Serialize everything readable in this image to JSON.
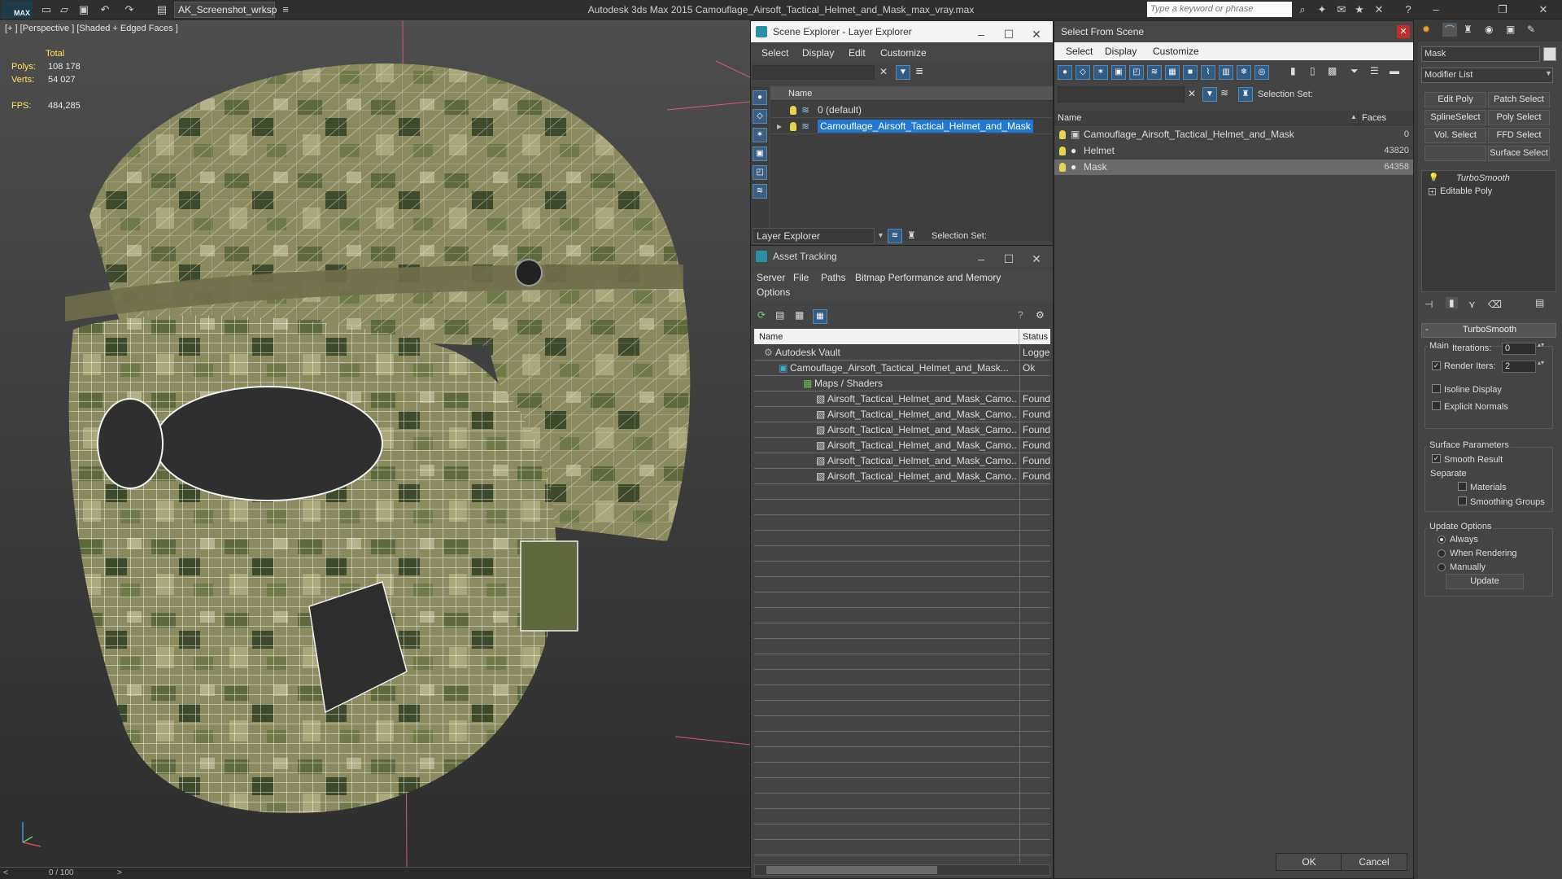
{
  "titlebar": {
    "logo": "MAX",
    "workspace": "AK_Screenshot_wrksp",
    "title": "Autodesk 3ds Max  2015    Camouflage_Airsoft_Tactical_Helmet_and_Mask_max_vray.max",
    "search_placeholder": "Type a keyword or phrase"
  },
  "viewport": {
    "label": "[+ ] [Perspective ] [Shaded + Edged Faces ]",
    "stats": {
      "total_label": "Total",
      "polys_label": "Polys:",
      "polys_value": "108 178",
      "verts_label": "Verts:",
      "verts_value": "54 027",
      "fps_label": "FPS:",
      "fps_value": "484,285"
    },
    "timeline": "0 / 100"
  },
  "scene_explorer": {
    "title": "Scene Explorer - Layer Explorer",
    "menu": [
      "Select",
      "Display",
      "Edit",
      "Customize"
    ],
    "col_name": "Name",
    "rows": [
      "0 (default)",
      "Camouflage_Airsoft_Tactical_Helmet_and_Mask"
    ],
    "footer_dropdown": "Layer Explorer",
    "selection_set": "Selection Set:"
  },
  "asset_tracking": {
    "title": "Asset Tracking",
    "menu": [
      "Server",
      "File",
      "Paths",
      "Bitmap Performance and Memory",
      "Options"
    ],
    "col_name": "Name",
    "col_status": "Status",
    "rows": [
      {
        "name": "Autodesk Vault",
        "status": "Logged"
      },
      {
        "name": "Camouflage_Airsoft_Tactical_Helmet_and_Mask...",
        "status": "Ok"
      },
      {
        "name": "Maps / Shaders",
        "status": ""
      },
      {
        "name": "Airsoft_Tactical_Helmet_and_Mask_Camo...",
        "status": "Found"
      },
      {
        "name": "Airsoft_Tactical_Helmet_and_Mask_Camo...",
        "status": "Found"
      },
      {
        "name": "Airsoft_Tactical_Helmet_and_Mask_Camo...",
        "status": "Found"
      },
      {
        "name": "Airsoft_Tactical_Helmet_and_Mask_Camo...",
        "status": "Found"
      },
      {
        "name": "Airsoft_Tactical_Helmet_and_Mask_Camo...",
        "status": "Found"
      },
      {
        "name": "Airsoft_Tactical_Helmet_and_Mask_Camo...",
        "status": "Found"
      }
    ]
  },
  "select_from_scene": {
    "title": "Select From Scene",
    "menu": [
      "Select",
      "Display",
      "Customize"
    ],
    "selection_set": "Selection Set:",
    "col_name": "Name",
    "col_faces": "Faces",
    "rows": [
      {
        "name": "Camouflage_Airsoft_Tactical_Helmet_and_Mask",
        "faces": "0"
      },
      {
        "name": "Helmet",
        "faces": "43820"
      },
      {
        "name": "Mask",
        "faces": "64358"
      }
    ],
    "ok": "OK",
    "cancel": "Cancel"
  },
  "command_panel": {
    "object_name": "Mask",
    "modifier_list": "Modifier List",
    "buttons": [
      "Edit Poly",
      "Patch Select",
      "SplineSelect",
      "Poly Select",
      "Vol. Select",
      "FFD Select",
      "Surface Select"
    ],
    "stack": [
      "TurboSmooth",
      "Editable Poly"
    ],
    "rollout_title": "TurboSmooth",
    "main_label": "Main",
    "iterations_label": "Iterations:",
    "iterations_value": "0",
    "render_iters_label": "Render Iters:",
    "render_iters_value": "2",
    "isoline": "Isoline Display",
    "explicit_normals": "Explicit Normals",
    "surface_params": "Surface Parameters",
    "smooth_result": "Smooth Result",
    "separate": "Separate",
    "materials": "Materials",
    "smoothing_groups": "Smoothing Groups",
    "update_options": "Update Options",
    "always": "Always",
    "when_rendering": "When Rendering",
    "manually": "Manually",
    "update": "Update"
  },
  "colors": {
    "selection_blue": "#1f78d1",
    "stat_label_yellow": "#ffe35a"
  }
}
